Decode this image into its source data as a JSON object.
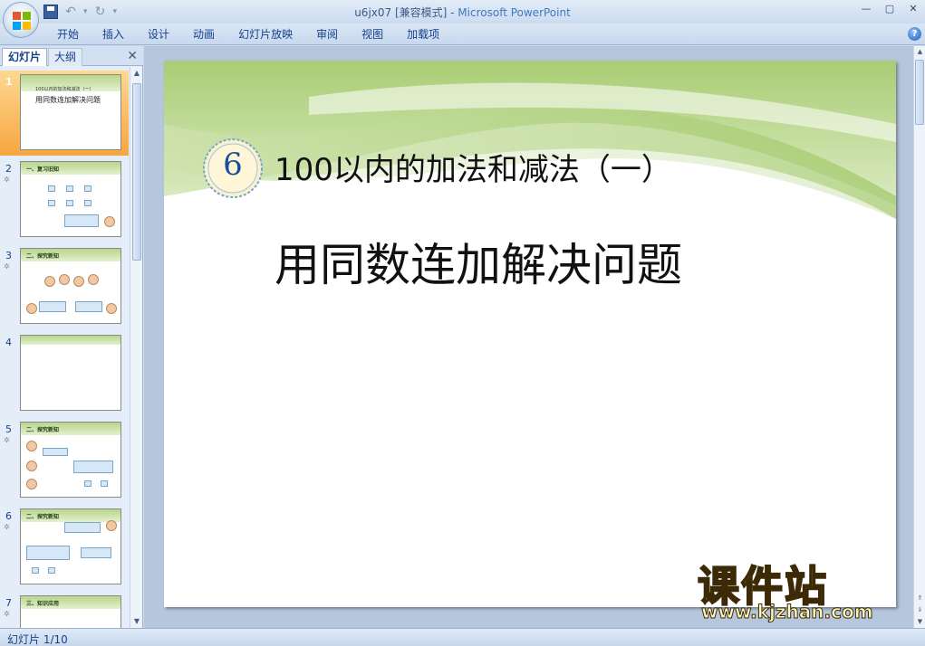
{
  "window": {
    "doc_name": "u6jx07 [兼容模式]",
    "separator": " - ",
    "app_name": "Microsoft PowerPoint"
  },
  "ribbon": {
    "tabs": [
      "开始",
      "插入",
      "设计",
      "动画",
      "幻灯片放映",
      "审阅",
      "视图",
      "加载项"
    ]
  },
  "side_panel": {
    "tabs": [
      "幻灯片",
      "大纲"
    ],
    "thumbnails": [
      {
        "num": "1",
        "title": "100以内的加法和减法（一）",
        "subtitle": "用同数连加解决问题"
      },
      {
        "num": "2",
        "title": "一、复习旧知"
      },
      {
        "num": "3",
        "title": "二、探究新知"
      },
      {
        "num": "4",
        "title": ""
      },
      {
        "num": "5",
        "title": "二、探究新知"
      },
      {
        "num": "6",
        "title": "二、探究新知"
      },
      {
        "num": "7",
        "title": "三、知识应用"
      }
    ]
  },
  "slide": {
    "badge_number": "6",
    "heading": "100以内的加法和减法（一）",
    "subtitle": "用同数连加解决问题",
    "colors": {
      "band": "#b7d58a",
      "badge_ring": "#6ea6d4",
      "badge_text": "#1a4e9c"
    }
  },
  "status": {
    "slide_indicator": "幻灯片 1/10"
  },
  "watermark": {
    "title": "课件站",
    "url": "www.kjzhan.com"
  }
}
